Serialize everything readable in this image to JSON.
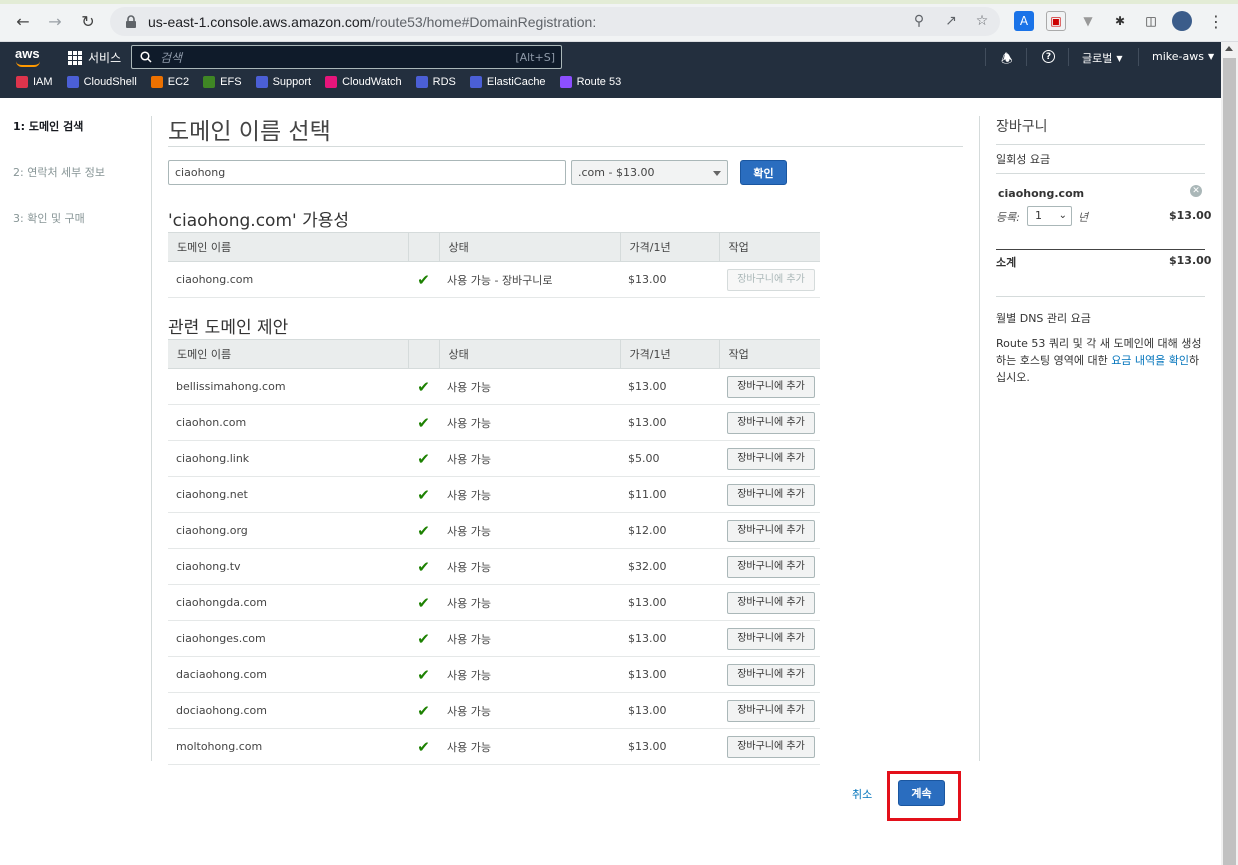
{
  "browser": {
    "url_host": "us-east-1.console.aws.amazon.com",
    "url_path": "/route53/home#DomainRegistration:"
  },
  "aws_nav": {
    "logo": "aws",
    "services_label": "서비스",
    "search_placeholder": "검색",
    "search_shortcut": "[Alt+S]",
    "region_label": "글로벌",
    "account_label": "mike-aws",
    "favorites": [
      {
        "label": "IAM",
        "color": "#dd344c"
      },
      {
        "label": "CloudShell",
        "color": "#4b5fd6"
      },
      {
        "label": "EC2",
        "color": "#ed7100"
      },
      {
        "label": "EFS",
        "color": "#3f8624"
      },
      {
        "label": "Support",
        "color": "#4b5fd6"
      },
      {
        "label": "CloudWatch",
        "color": "#e7157b"
      },
      {
        "label": "RDS",
        "color": "#4b5fd6"
      },
      {
        "label": "ElastiCache",
        "color": "#4b5fd6"
      },
      {
        "label": "Route 53",
        "color": "#8c4fff"
      }
    ]
  },
  "steps": [
    {
      "label": "1: 도메인 검색",
      "active": true
    },
    {
      "label": "2: 연락처 세부 정보",
      "active": false
    },
    {
      "label": "3: 확인 및 구매",
      "active": false
    }
  ],
  "main": {
    "title": "도메인 이름 선택",
    "domain_input_value": "ciaohong",
    "tld_select_value": ".com - $13.00",
    "check_button": "확인",
    "availability_heading": "'ciaohong.com' 가용성",
    "columns": [
      "도메인 이름",
      "",
      "상태",
      "가격/1년",
      "작업"
    ],
    "availability_row": {
      "domain": "ciaohong.com",
      "status": "사용 가능 - 장바구니로",
      "price": "$13.00",
      "action": "장바구니에 추가"
    },
    "related_heading": "관련 도메인 제안",
    "related_rows": [
      {
        "domain": "bellissimahong.com",
        "status": "사용 가능",
        "price": "$13.00",
        "action": "장바구니에 추가"
      },
      {
        "domain": "ciaohon.com",
        "status": "사용 가능",
        "price": "$13.00",
        "action": "장바구니에 추가"
      },
      {
        "domain": "ciaohong.link",
        "status": "사용 가능",
        "price": "$5.00",
        "action": "장바구니에 추가"
      },
      {
        "domain": "ciaohong.net",
        "status": "사용 가능",
        "price": "$11.00",
        "action": "장바구니에 추가"
      },
      {
        "domain": "ciaohong.org",
        "status": "사용 가능",
        "price": "$12.00",
        "action": "장바구니에 추가"
      },
      {
        "domain": "ciaohong.tv",
        "status": "사용 가능",
        "price": "$32.00",
        "action": "장바구니에 추가"
      },
      {
        "domain": "ciaohongda.com",
        "status": "사용 가능",
        "price": "$13.00",
        "action": "장바구니에 추가"
      },
      {
        "domain": "ciaohonges.com",
        "status": "사용 가능",
        "price": "$13.00",
        "action": "장바구니에 추가"
      },
      {
        "domain": "daciaohong.com",
        "status": "사용 가능",
        "price": "$13.00",
        "action": "장바구니에 추가"
      },
      {
        "domain": "dociaohong.com",
        "status": "사용 가능",
        "price": "$13.00",
        "action": "장바구니에 추가"
      },
      {
        "domain": "moltohong.com",
        "status": "사용 가능",
        "price": "$13.00",
        "action": "장바구니에 추가"
      }
    ]
  },
  "cart": {
    "title": "장바구니",
    "one_time_label": "일회성 요금",
    "item_domain": "ciaohong.com",
    "register_label": "등록:",
    "years_value": "1",
    "years_unit": "년",
    "item_price": "$13.00",
    "subtotal_label": "소계",
    "subtotal_value": "$13.00",
    "monthly_label": "월별 DNS 관리 요금",
    "monthly_text_1": "Route 53 쿼리 및 각 새 도메인에 대해 생성하는 호스팅 영역에 대한 ",
    "monthly_link": "요금 내역을 확인",
    "monthly_text_2": "하십시오."
  },
  "footer": {
    "cancel": "취소",
    "continue": "계속"
  }
}
